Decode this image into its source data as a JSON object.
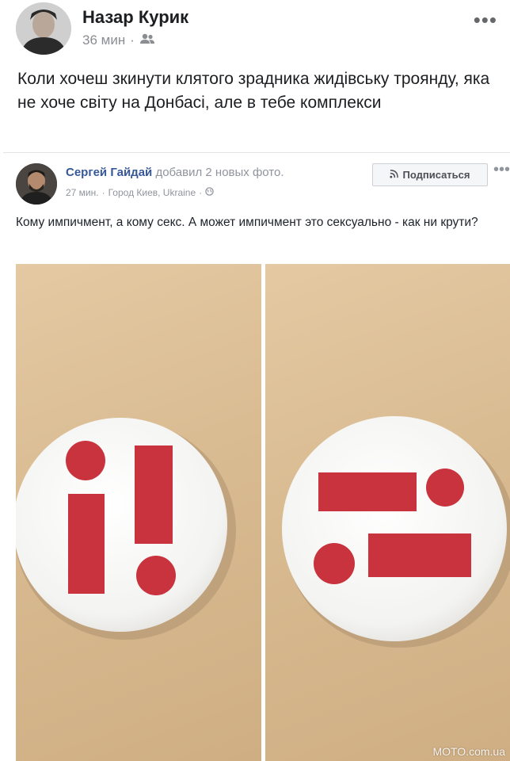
{
  "outer_post": {
    "author": "Назар Курик",
    "time": "36 мин",
    "separator": "·",
    "audience_icon": "friends-icon",
    "more_icon": "more-horizontal-icon",
    "more_symbol": "•••",
    "text": "Коли хочеш зкинути клятого зрадника жидівську троянду, яка не хоче світу на Донбасі, але в тебе комплекси"
  },
  "shared_post": {
    "author": "Сергей Гайдай",
    "action": " добавил 2 новых фото.",
    "time": "27 мин.",
    "separator": "·",
    "location": "Город Киев, Ukraine",
    "separator2": "·",
    "audience_icon": "globe-icon",
    "subscribe_label": "Подписаться",
    "subscribe_icon": "rss-icon",
    "more_symbol": "•••",
    "text": "Кому импичмент, а кому секс. А может импичмент это сексуально - как ни крути?"
  },
  "photos": [
    {
      "name": "badge-exclamation-photo",
      "symbol": "i!"
    },
    {
      "name": "badge-equals-photo",
      "symbol": "="
    }
  ],
  "colors": {
    "badge_red": "#c8333e",
    "badge_white": "#f7f7f7",
    "link_blue": "#365899"
  },
  "watermark": "MOTO.com.ua"
}
